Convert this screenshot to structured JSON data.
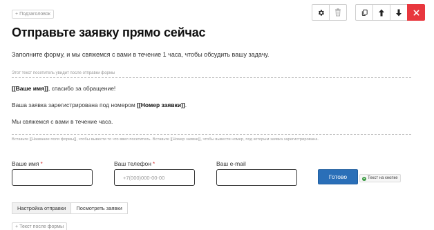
{
  "top_tag": {
    "plus": "+",
    "label": "Подзаголовок"
  },
  "toolbar_left": {
    "buttons": [
      {
        "icon": "gear-icon"
      },
      {
        "icon": "trash-icon"
      }
    ]
  },
  "toolbar_right": {
    "buttons": [
      {
        "icon": "copy-icon"
      },
      {
        "icon": "arrow-up-icon"
      },
      {
        "icon": "arrow-down-icon"
      },
      {
        "icon": "close-icon"
      }
    ],
    "danger_color": "#e8373e"
  },
  "title": "Отправьте заявку прямо сейчас",
  "subtitle": "Заполните форму, и мы свяжемся с вами в течение 1 часа, чтобы обсудить вашу задачу.",
  "after_submit_hint": "Этот текст посетитель увидит после отправки формы",
  "message": {
    "line1_name": "[[Ваше имя]]",
    "line1_rest": ", спасибо за обращение!",
    "line2_pre": "Ваша заявка зарегистрирована под номером ",
    "line2_number": "[[Номер заявки]]",
    "line2_post": ".",
    "line3": "Мы свяжемся с вами в течение часа."
  },
  "insert_hint": "Вставьте [[Название поля формы]], чтобы вывести то что ввел посетитель. Вставьте [[Номер заявки]], чтобы вывести номер, под которым заявка зарегистрирована.",
  "fields": [
    {
      "label": "Ваше имя",
      "required": "*",
      "placeholder": ""
    },
    {
      "label": "Ваш телефон",
      "required": "*",
      "placeholder": "+7(000)000-00-00"
    },
    {
      "label": "Ваш e-mail",
      "required": "",
      "placeholder": ""
    }
  ],
  "submit_label": "Готово",
  "button_text_tag": {
    "plus": "+",
    "label": "Текст на кнопке"
  },
  "tabs": [
    {
      "label": "Настройка отправки",
      "active": true
    },
    {
      "label": "Посмотреть заявки",
      "active": false
    }
  ],
  "bottom_tag": {
    "plus": "+",
    "label": "Текст после формы"
  },
  "colors": {
    "accent": "#2a6fb8",
    "danger": "#e8373e",
    "required": "#d23b3b",
    "tag_green": "#3b9b42"
  }
}
